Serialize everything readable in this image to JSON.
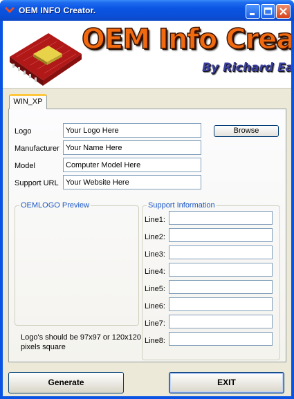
{
  "window": {
    "title": "OEM INFO Creator."
  },
  "banner": {
    "title": "OEM Info Creator",
    "author": "By Richard Easton"
  },
  "tabs": [
    {
      "label": "WIN_XP"
    }
  ],
  "form": {
    "logo": {
      "label": "Logo",
      "value": "Your Logo Here"
    },
    "manufacturer": {
      "label": "Manufacturer",
      "value": "Your Name Here"
    },
    "model": {
      "label": "Model",
      "value": "Computer Model Here"
    },
    "support_url": {
      "label": "Support URL",
      "value": "Your Website Here"
    },
    "browse_label": "Browse"
  },
  "preview": {
    "title": "OEMLOGO Preview",
    "note": "Logo's should be 97x97 or 120x120 pixels square"
  },
  "support": {
    "title": "Support Information",
    "lines": [
      {
        "label": "Line1:",
        "value": ""
      },
      {
        "label": "Line2:",
        "value": ""
      },
      {
        "label": "Line3:",
        "value": ""
      },
      {
        "label": "Line4:",
        "value": ""
      },
      {
        "label": "Line5:",
        "value": ""
      },
      {
        "label": "Line6:",
        "value": ""
      },
      {
        "label": "Line7:",
        "value": ""
      },
      {
        "label": "Line8:",
        "value": ""
      }
    ]
  },
  "buttons": {
    "generate": "Generate",
    "exit": "EXIT"
  },
  "colors": {
    "titlebar": "#0a54e3",
    "accent_text": "#1c57c9",
    "banner_title": "#f26a10"
  },
  "icons": [
    "app-chevron-icon",
    "minimize-icon",
    "maximize-icon",
    "close-icon",
    "cpu-chip-icon"
  ]
}
